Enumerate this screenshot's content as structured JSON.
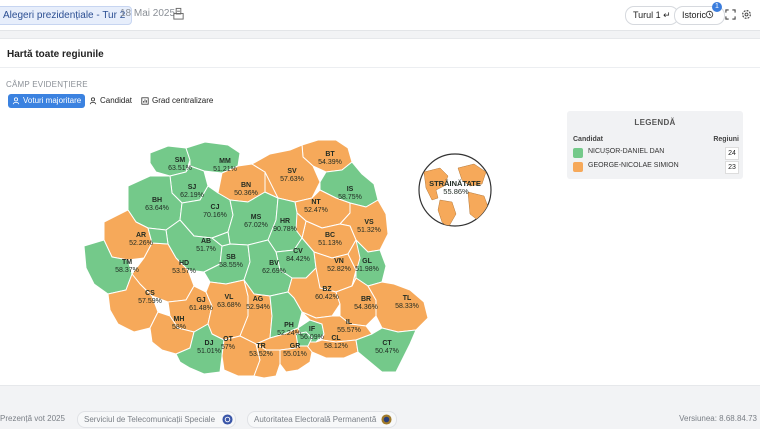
{
  "header": {
    "election_title": "Alegeri prezidențiale - Tur 2",
    "date": "18 Mai 2025",
    "round_button": "Turul 1 ↵",
    "history_button": "Istoric",
    "history_badge": "1"
  },
  "panel": {
    "title": "Hartă toate regiunile",
    "highlight_label": "CÂMP EVIDENȚIERE",
    "options": [
      "Voturi majoritare",
      "Candidat",
      "Grad centralizare"
    ]
  },
  "legend": {
    "title": "LEGENDĂ",
    "col_candidate": "Candidat",
    "col_regions": "Regiuni",
    "rows": [
      {
        "name": "NICUȘOR-DANIEL DAN",
        "count": "24",
        "color": "#74c98a"
      },
      {
        "name": "GEORGE-NICOLAE SIMION",
        "count": "23",
        "color": "#f6a95a"
      }
    ]
  },
  "colors": {
    "dan": "#74c98a",
    "simion": "#f6a95a",
    "accent": "#3b82e0"
  },
  "regions": [
    {
      "code": "SM",
      "pct": "63.51%",
      "winner": "dan"
    },
    {
      "code": "MM",
      "pct": "51.21%",
      "winner": "dan"
    },
    {
      "code": "BT",
      "pct": "54.39%",
      "winner": "simion"
    },
    {
      "code": "SJ",
      "pct": "62.19%",
      "winner": "dan"
    },
    {
      "code": "BN",
      "pct": "50.36%",
      "winner": "simion"
    },
    {
      "code": "SV",
      "pct": "57.63%",
      "winner": "simion"
    },
    {
      "code": "BH",
      "pct": "63.64%",
      "winner": "dan"
    },
    {
      "code": "CJ",
      "pct": "70.16%",
      "winner": "dan"
    },
    {
      "code": "IS",
      "pct": "58.75%",
      "winner": "dan"
    },
    {
      "code": "NT",
      "pct": "52.47%",
      "winner": "simion"
    },
    {
      "code": "MS",
      "pct": "67.02%",
      "winner": "dan"
    },
    {
      "code": "HR",
      "pct": "90.78%",
      "winner": "dan"
    },
    {
      "code": "VS",
      "pct": "51.32%",
      "winner": "simion"
    },
    {
      "code": "AR",
      "pct": "52.26%",
      "winner": "simion"
    },
    {
      "code": "BC",
      "pct": "51.13%",
      "winner": "simion"
    },
    {
      "code": "AB",
      "pct": "51.7%",
      "winner": "dan"
    },
    {
      "code": "CV",
      "pct": "84.42%",
      "winner": "dan"
    },
    {
      "code": "SB",
      "pct": "58.55%",
      "winner": "dan"
    },
    {
      "code": "BV",
      "pct": "62.69%",
      "winner": "dan"
    },
    {
      "code": "VN",
      "pct": "52.82%",
      "winner": "simion"
    },
    {
      "code": "GL",
      "pct": "51.98%",
      "winner": "dan"
    },
    {
      "code": "TM",
      "pct": "58.37%",
      "winner": "dan"
    },
    {
      "code": "HD",
      "pct": "53.57%",
      "winner": "simion"
    },
    {
      "code": "BZ",
      "pct": "60.42%",
      "winner": "simion"
    },
    {
      "code": "CS",
      "pct": "57.59%",
      "winner": "simion"
    },
    {
      "code": "GJ",
      "pct": "61.48%",
      "winner": "simion"
    },
    {
      "code": "VL",
      "pct": "63.68%",
      "winner": "simion"
    },
    {
      "code": "AG",
      "pct": "52.94%",
      "winner": "simion"
    },
    {
      "code": "PH",
      "pct": "52.24%",
      "winner": "dan"
    },
    {
      "code": "BR",
      "pct": "54.36%",
      "winner": "simion"
    },
    {
      "code": "TL",
      "pct": "58.33%",
      "winner": "simion"
    },
    {
      "code": "MH",
      "pct": "58%",
      "winner": "simion"
    },
    {
      "code": "IF",
      "pct": "56.09%",
      "winner": "dan"
    },
    {
      "code": "IL",
      "pct": "55.57%",
      "winner": "simion"
    },
    {
      "code": "DB",
      "pct": "",
      "winner": "simion"
    },
    {
      "code": "DJ",
      "pct": "51.01%",
      "winner": "dan"
    },
    {
      "code": "OT",
      "pct": "57%",
      "winner": "simion"
    },
    {
      "code": "CL",
      "pct": "58.12%",
      "winner": "simion"
    },
    {
      "code": "CT",
      "pct": "50.47%",
      "winner": "dan"
    },
    {
      "code": "TR",
      "pct": "53.52%",
      "winner": "simion"
    },
    {
      "code": "GR",
      "pct": "55.01%",
      "winner": "simion"
    },
    {
      "code": "B",
      "pct": "",
      "winner": "dan"
    },
    {
      "code": "AB2",
      "pct": "",
      "winner": "dan"
    },
    {
      "code": "MS2",
      "pct": "",
      "winner": "dan"
    },
    {
      "code": "NT2",
      "pct": "",
      "winner": "simion"
    },
    {
      "code": "SV2",
      "pct": "",
      "winner": "simion"
    },
    {
      "code": "VN2",
      "pct": "",
      "winner": "simion"
    }
  ],
  "abroad": {
    "label": "STRĂINĂTATE",
    "pct": "55.86%",
    "winner": "simion"
  },
  "footer": {
    "left": "Prezență vot 2025",
    "chip1": "Serviciul de Telecomunicații Speciale",
    "chip2": "Autoritatea Electorală Permanentă",
    "version": "Versiunea: 8.68.84.73"
  }
}
